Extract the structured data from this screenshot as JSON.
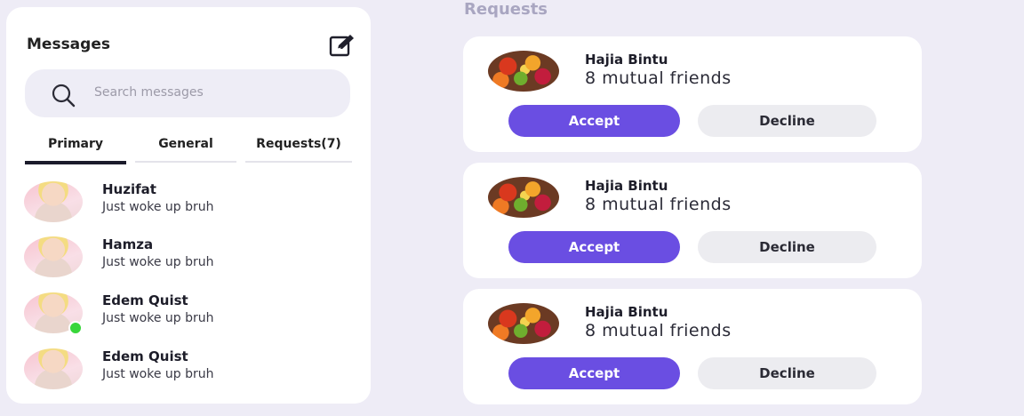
{
  "messages": {
    "title": "Messages",
    "search_placeholder": "Search messages",
    "tabs": [
      {
        "label": "Primary",
        "active": true
      },
      {
        "label": "General",
        "active": false
      },
      {
        "label": "Requests(7)",
        "active": false
      }
    ],
    "chats": [
      {
        "name": "Huzifat",
        "preview": "Just woke up bruh",
        "online": false
      },
      {
        "name": "Hamza",
        "preview": "Just woke up bruh",
        "online": false
      },
      {
        "name": "Edem Quist",
        "preview": "Just woke up bruh",
        "online": true
      },
      {
        "name": "Edem Quist",
        "preview": "Just woke up bruh",
        "online": false
      }
    ]
  },
  "requests": {
    "title": "Requests",
    "items": [
      {
        "name": "Hajia Bintu",
        "mutual": "8 mutual friends",
        "accept_label": "Accept",
        "decline_label": "Decline"
      },
      {
        "name": "Hajia Bintu",
        "mutual": "8 mutual friends",
        "accept_label": "Accept",
        "decline_label": "Decline"
      },
      {
        "name": "Hajia Bintu",
        "mutual": "8 mutual friends",
        "accept_label": "Accept",
        "decline_label": "Decline"
      }
    ]
  },
  "icons": {
    "compose": "edit-icon",
    "search": "search-icon",
    "online": "online-status-dot"
  },
  "colors": {
    "background": "#eeecf6",
    "accent": "#6a4ee2",
    "decline_button": "#ececf0",
    "online": "#38d63a",
    "requests_heading": "#a9a6c1"
  }
}
